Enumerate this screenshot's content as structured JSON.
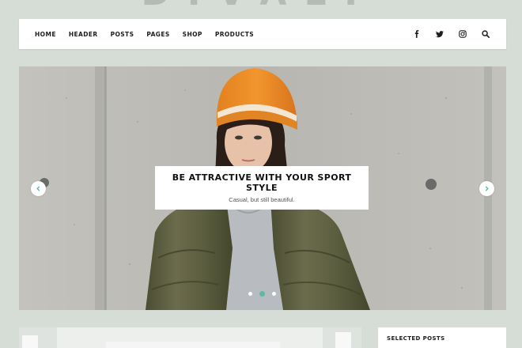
{
  "site": {
    "logo_text": "DIVALY"
  },
  "nav": {
    "items": [
      {
        "label": "HOME"
      },
      {
        "label": "HEADER"
      },
      {
        "label": "POSTS"
      },
      {
        "label": "PAGES"
      },
      {
        "label": "SHOP"
      },
      {
        "label": "PRODUCTS"
      }
    ],
    "icons": [
      "facebook-icon",
      "twitter-icon",
      "instagram-icon",
      "search-icon"
    ]
  },
  "slider": {
    "title": "BE ATTRACTIVE WITH YOUR SPORT STYLE",
    "subtitle": "Casual, but still beautiful.",
    "slide_count": 3,
    "active_slide": 2,
    "accent_color": "#5fb9a4"
  },
  "sidebar": {
    "widget_title": "SELECTED POSTS"
  }
}
